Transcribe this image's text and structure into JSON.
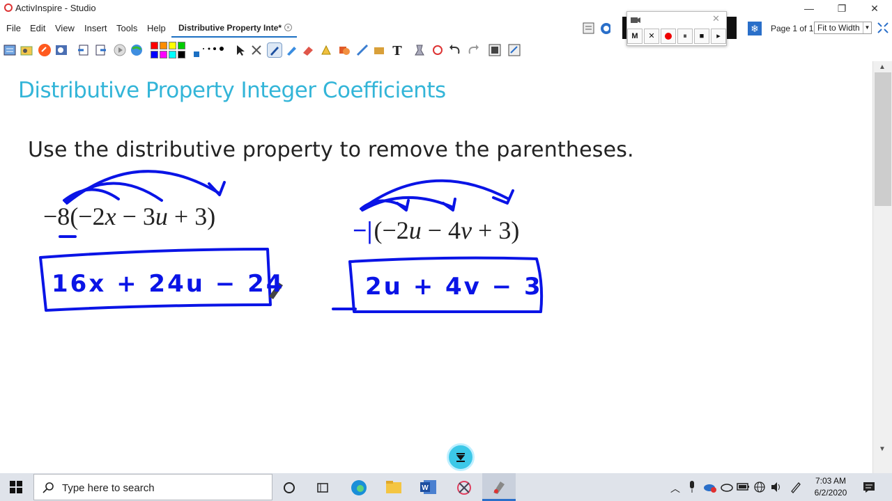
{
  "window": {
    "title": "ActivInspire - Studio",
    "minimize": "—",
    "restore": "❐",
    "close": "✕"
  },
  "menu": {
    "items": [
      "File",
      "Edit",
      "View",
      "Insert",
      "Tools",
      "Help"
    ]
  },
  "document_tab": {
    "label": "Distributive Property Inte*",
    "close": "×"
  },
  "page_nav": {
    "page_info": "Page 1 of 1",
    "zoom": "Fit to Width"
  },
  "recorder": {
    "mute": "M",
    "cancel": "✕",
    "pause": "⏸",
    "stop": "■",
    "next": "▸"
  },
  "palette": {
    "colors": [
      "#ff0000",
      "#ff8c00",
      "#ffff00",
      "#00cc00",
      "#0000ff",
      "#ff00ff",
      "#00ffff",
      "#000000"
    ]
  },
  "flipchart": {
    "heading": "Distributive Property Integer Coefficients",
    "instruction": "Use the distributive property to remove the parentheses.",
    "problem1": {
      "factor": "−8",
      "open": "(−2",
      "v1": "x",
      "mid1": " − 3",
      "v2": "u",
      "tail": " + 3)"
    },
    "problem2": {
      "factor": "−",
      "open": "(−2",
      "v1": "u",
      "mid1": " − 4",
      "v2": "v",
      "tail": " + 3)"
    },
    "answer1": "16x + 24u − 24",
    "answer2": "2u + 4v − 3",
    "ink_color": "#0a14e6"
  },
  "taskbar": {
    "search_placeholder": "Type here to search",
    "time": "7:03 AM",
    "date": "6/2/2020"
  },
  "colors": {
    "heading": "#33b5d8",
    "accent": "#1b6fc2",
    "ink": "#0a14e6"
  }
}
